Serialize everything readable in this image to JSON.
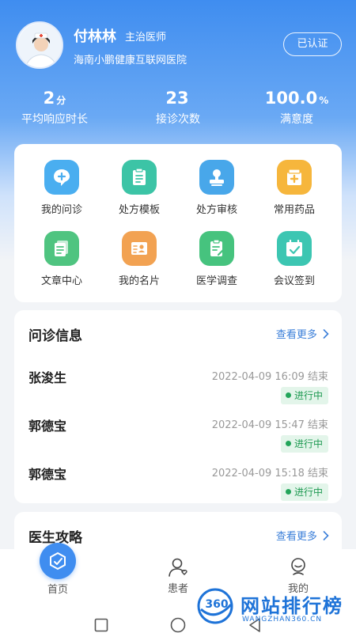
{
  "doctor": {
    "name": "付林林",
    "title": "主治医师",
    "hospital": "海南小鹏健康互联网医院",
    "verify_label": "已认证"
  },
  "stats": [
    {
      "value": "2",
      "unit": "分",
      "label": "平均响应时长"
    },
    {
      "value": "23",
      "unit": "",
      "label": "接诊次数"
    },
    {
      "value": "100.0",
      "unit": "%",
      "label": "满意度"
    }
  ],
  "features": [
    {
      "label": "我的问诊",
      "icon": "chat-plus-icon",
      "color": "#4aaef0"
    },
    {
      "label": "处方模板",
      "icon": "clipboard-icon",
      "color": "#3cc4a6"
    },
    {
      "label": "处方审核",
      "icon": "stamp-icon",
      "color": "#48a7ea"
    },
    {
      "label": "常用药品",
      "icon": "medicine-box-icon",
      "color": "#f6b63c"
    },
    {
      "label": "文章中心",
      "icon": "document-icon",
      "color": "#4fc480"
    },
    {
      "label": "我的名片",
      "icon": "business-card-icon",
      "color": "#f2a252"
    },
    {
      "label": "医学调查",
      "icon": "survey-icon",
      "color": "#46c37e"
    },
    {
      "label": "会议签到",
      "icon": "calendar-check-icon",
      "color": "#3cc6b2"
    }
  ],
  "consult": {
    "title": "问诊信息",
    "see_more": "查看更多",
    "items": [
      {
        "name": "张浚生",
        "time": "2022-04-09 16:09 结束",
        "status": "进行中"
      },
      {
        "name": "郭德宝",
        "time": "2022-04-09 15:47 结束",
        "status": "进行中"
      },
      {
        "name": "郭德宝",
        "time": "2022-04-09 15:18 结束",
        "status": "进行中"
      }
    ]
  },
  "strategy": {
    "title": "医生攻略",
    "see_more": "查看更多"
  },
  "tabs": [
    {
      "label": "首页",
      "icon": "home-icon"
    },
    {
      "label": "患者",
      "icon": "patient-icon"
    },
    {
      "label": "我的",
      "icon": "profile-icon"
    }
  ],
  "watermark": {
    "logo_text": "360",
    "name": "网站排行榜",
    "url": "WANGZHAN360.CN"
  },
  "colors": {
    "brand_blue": "#3f8df0",
    "status_green": "#23a55a",
    "link_blue": "#3b7fd9"
  }
}
